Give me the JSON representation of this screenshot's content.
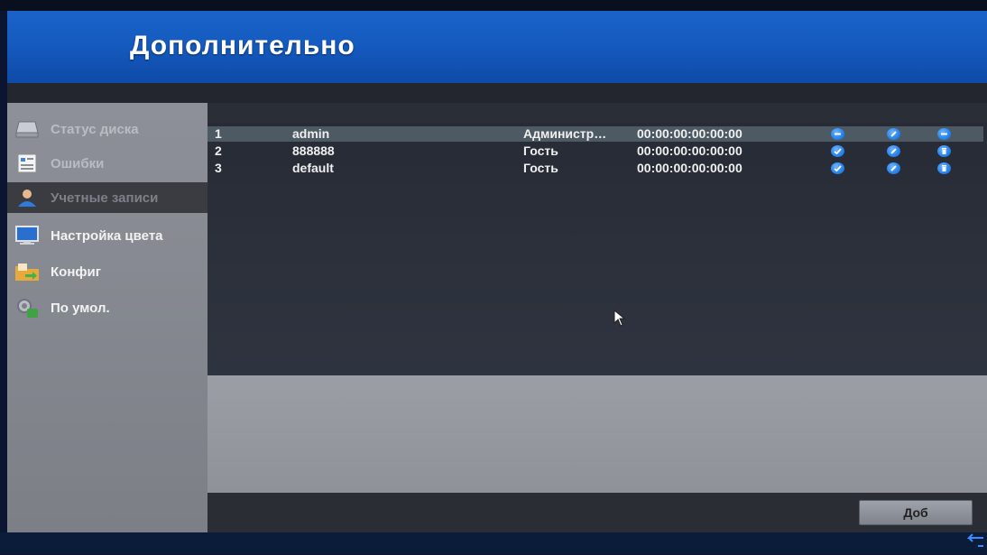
{
  "header": {
    "title": "Дополнительно"
  },
  "sidebar": {
    "items": [
      {
        "label": "Статус диска",
        "icon": "hdd-icon"
      },
      {
        "label": "Ошибки",
        "icon": "log-icon"
      },
      {
        "label": "Учетные записи",
        "icon": "user-account-icon",
        "active": true
      },
      {
        "label": "Настройка цвета",
        "icon": "monitor-icon"
      },
      {
        "label": "Конфиг",
        "icon": "folder-export-icon"
      },
      {
        "label": "По умол.",
        "icon": "gear-default-icon"
      }
    ]
  },
  "users": {
    "rows": [
      {
        "no": "1",
        "name": "admin",
        "level": "Администр…",
        "mac": "00:00:00:00:00:00",
        "actions": [
          "minus-icon",
          "edit-icon",
          "minus-icon"
        ],
        "selected": true
      },
      {
        "no": "2",
        "name": "888888",
        "level": "Гость",
        "mac": "00:00:00:00:00:00",
        "actions": [
          "check-icon",
          "edit-icon",
          "delete-icon"
        ]
      },
      {
        "no": "3",
        "name": "default",
        "level": "Гость",
        "mac": "00:00:00:00:00:00",
        "actions": [
          "check-icon",
          "edit-icon",
          "delete-icon"
        ]
      }
    ]
  },
  "footer": {
    "add_label": "Доб"
  },
  "colors": {
    "header_blue": "#155bc0",
    "sidebar_gray": "#868991",
    "row_selected": "#4d5a63",
    "action_blue": "#2a86ee"
  }
}
